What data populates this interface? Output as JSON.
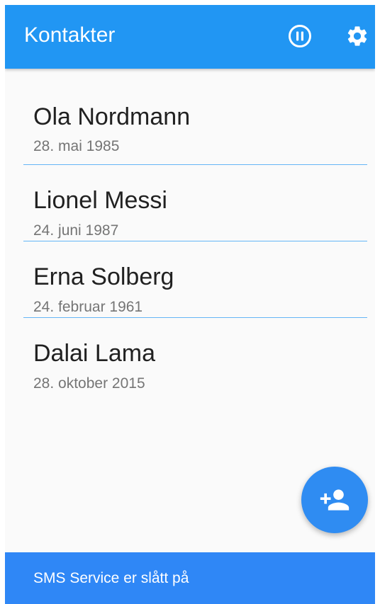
{
  "app_bar": {
    "title": "Kontakter",
    "actions": [
      {
        "name": "pause",
        "icon": "pause-circle-icon"
      },
      {
        "name": "settings",
        "icon": "gear-icon"
      }
    ],
    "color": "#2196f3"
  },
  "contacts": [
    {
      "name": "Ola Nordmann",
      "date": "28. mai 1985"
    },
    {
      "name": "Lionel Messi",
      "date": "24. juni 1987"
    },
    {
      "name": "Erna Solberg",
      "date": "24. februar 1961"
    },
    {
      "name": "Dalai Lama",
      "date": "28. oktober 2015"
    }
  ],
  "fab": {
    "icon": "person-add-icon",
    "color": "#2f8cf2"
  },
  "status": {
    "text": "SMS Service er slått på",
    "color": "#2f87f6"
  }
}
